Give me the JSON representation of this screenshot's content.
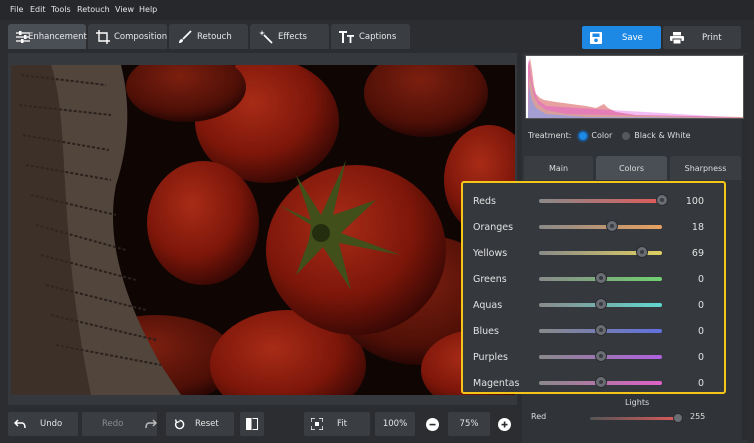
{
  "menu": [
    "File",
    "Edit",
    "Tools",
    "Retouch",
    "View",
    "Help"
  ],
  "tabs": [
    {
      "label": "Enhancement",
      "icon": "sliders-icon"
    },
    {
      "label": "Composition",
      "icon": "crop-icon"
    },
    {
      "label": "Retouch",
      "icon": "brush-icon"
    },
    {
      "label": "Effects",
      "icon": "magic-wand-icon"
    },
    {
      "label": "Captions",
      "icon": "text-icon"
    }
  ],
  "actions": {
    "save": "Save",
    "print": "Print"
  },
  "treatment": {
    "label": "Treatment:",
    "color": "Color",
    "bw": "Black & White"
  },
  "panel_tabs": [
    "Main",
    "Colors",
    "Sharpness"
  ],
  "colors": [
    {
      "label": "Reds",
      "value": "100",
      "pos": 1.0,
      "grad": "linear-gradient(90deg,#8a8a8a,#e05a5a)"
    },
    {
      "label": "Oranges",
      "value": "18",
      "pos": 0.59,
      "grad": "linear-gradient(90deg,#8a8a8a,#e8a060)"
    },
    {
      "label": "Yellows",
      "value": "69",
      "pos": 0.84,
      "grad": "linear-gradient(90deg,#8a8a8a,#e0d060)"
    },
    {
      "label": "Greens",
      "value": "0",
      "pos": 0.5,
      "grad": "linear-gradient(90deg,#8a8a8a,#70d070)"
    },
    {
      "label": "Aquas",
      "value": "0",
      "pos": 0.5,
      "grad": "linear-gradient(90deg,#8a8a8a,#60d8d0)"
    },
    {
      "label": "Blues",
      "value": "0",
      "pos": 0.5,
      "grad": "linear-gradient(90deg,#8a8a8a,#6070e0)"
    },
    {
      "label": "Purples",
      "value": "0",
      "pos": 0.5,
      "grad": "linear-gradient(90deg,#8a8a8a,#b060e0)"
    },
    {
      "label": "Magentas",
      "value": "0",
      "pos": 0.5,
      "grad": "linear-gradient(90deg,#8a8a8a,#e060c8)"
    }
  ],
  "lights": {
    "title": "Lights",
    "red_label": "Red",
    "red_value": "255"
  },
  "bottom": {
    "undo": "Undo",
    "redo": "Redo",
    "reset": "Reset",
    "fit": "Fit",
    "zoom100": "100%",
    "zoom": "75%"
  },
  "accent": "#1e88e5",
  "highlight": "#f5c518"
}
